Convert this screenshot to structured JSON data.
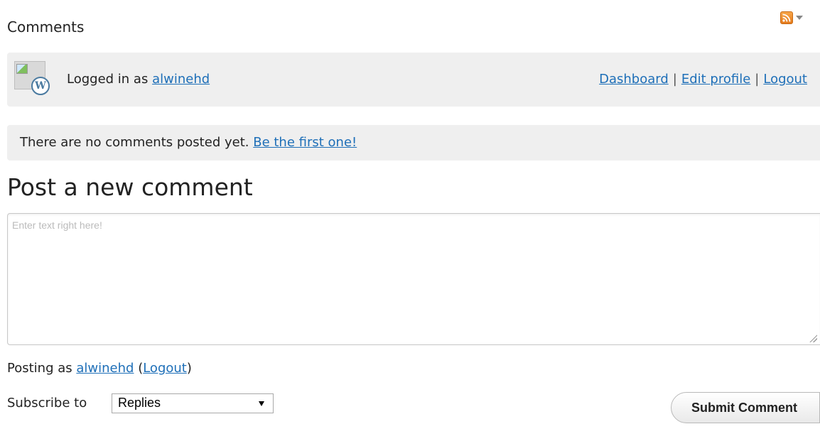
{
  "header": {
    "title": "Comments",
    "rss_icon": "rss-icon",
    "menu_icon": "chevron-down-icon"
  },
  "login_bar": {
    "prefix": "Logged in as",
    "username": "alwinehd",
    "links": [
      "Dashboard",
      "Edit profile",
      "Logout"
    ],
    "separator": "|"
  },
  "empty_state": {
    "message": "There are no comments posted yet.",
    "cta": "Be the first one!"
  },
  "form": {
    "heading": "Post a new comment",
    "placeholder": "Enter text right here!",
    "value": "",
    "posting_prefix": "Posting as",
    "posting_user": "alwinehd",
    "posting_logout": "Logout",
    "subscribe_label": "Subscribe to",
    "subscribe_selected": "Replies",
    "submit_label": "Submit Comment"
  },
  "colors": {
    "link": "#1e6fb8",
    "panel_bg": "#efefef",
    "rss_orange": "#f29b3b"
  }
}
